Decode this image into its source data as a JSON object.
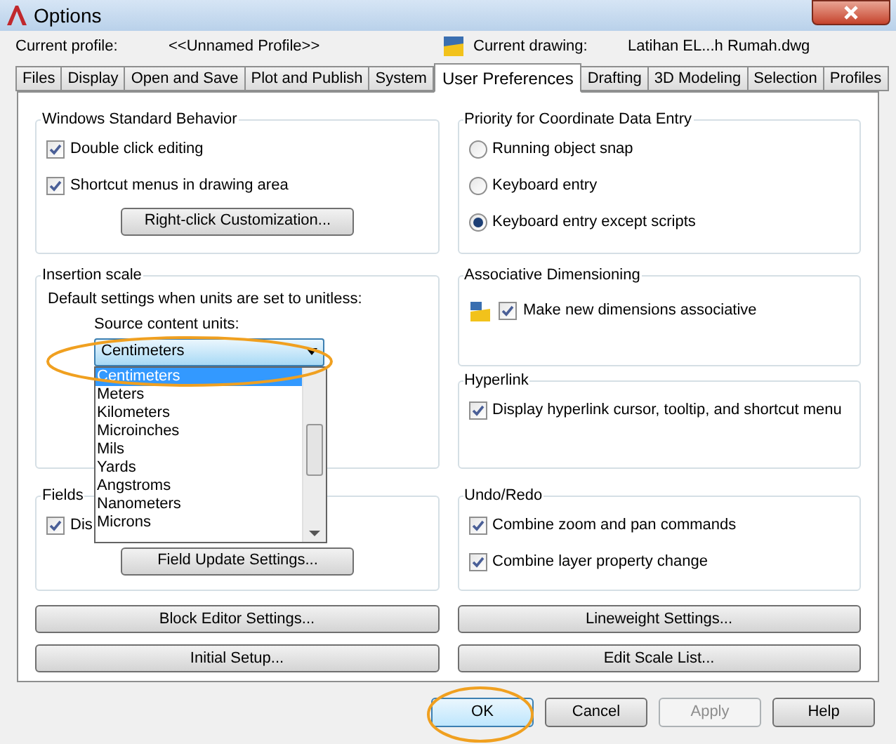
{
  "window": {
    "title": "Options"
  },
  "header": {
    "profile_label": "Current profile:",
    "profile": "<<Unnamed Profile>>",
    "drawing_label": "Current drawing:",
    "drawing": "Latihan EL...h Rumah.dwg"
  },
  "tabs": [
    {
      "label": "Files",
      "selected": false
    },
    {
      "label": "Display",
      "selected": false
    },
    {
      "label": "Open and Save",
      "selected": false
    },
    {
      "label": "Plot and Publish",
      "selected": false
    },
    {
      "label": "System",
      "selected": false
    },
    {
      "label": "User Preferences",
      "selected": true
    },
    {
      "label": "Drafting",
      "selected": false
    },
    {
      "label": "3D Modeling",
      "selected": false
    },
    {
      "label": "Selection",
      "selected": false
    },
    {
      "label": "Profiles",
      "selected": false
    }
  ],
  "left_groups": [
    {
      "title": "Windows Standard Behavior",
      "items": [
        {
          "kind": "checkbox",
          "label": "Double click editing",
          "checked": true
        },
        {
          "kind": "checkbox",
          "label": "Shortcut menus in drawing area",
          "checked": true
        },
        {
          "kind": "button",
          "label": "Right-click Customization..."
        }
      ]
    },
    {
      "title": "Insertion scale",
      "items": [
        {
          "kind": "text",
          "label": "Default settings when units are set to unitless:"
        },
        {
          "kind": "combo",
          "label": "Source content units:",
          "value": "Centimeters",
          "expanded": true,
          "options": [
            {
              "label": "Centimeters",
              "selected": true
            },
            {
              "label": "Meters",
              "selected": false
            },
            {
              "label": "Kilometers",
              "selected": false
            },
            {
              "label": "Microinches",
              "selected": false
            },
            {
              "label": "Mils",
              "selected": false
            },
            {
              "label": "Yards",
              "selected": false
            },
            {
              "label": "Angstroms",
              "selected": false
            },
            {
              "label": "Nanometers",
              "selected": false
            },
            {
              "label": "Microns",
              "selected": false
            }
          ]
        }
      ]
    },
    {
      "title": "Fields",
      "items": [
        {
          "kind": "checkbox",
          "label": "Dis",
          "checked": true
        },
        {
          "kind": "button",
          "label": "Field Update Settings..."
        }
      ]
    }
  ],
  "right_groups": [
    {
      "title": "Priority for Coordinate Data Entry",
      "items": [
        {
          "kind": "radio",
          "label": "Running object snap",
          "selected": false
        },
        {
          "kind": "radio",
          "label": "Keyboard entry",
          "selected": false
        },
        {
          "kind": "radio",
          "label": "Keyboard entry except scripts",
          "selected": true
        }
      ]
    },
    {
      "title": "Associative Dimensioning",
      "items": [
        {
          "kind": "icon_checkbox",
          "label": "Make new dimensions associative",
          "checked": true
        }
      ]
    },
    {
      "title": "Hyperlink",
      "items": [
        {
          "kind": "checkbox",
          "label": "Display hyperlink cursor, tooltip, and shortcut menu",
          "checked": true
        }
      ]
    },
    {
      "title": "Undo/Redo",
      "items": [
        {
          "kind": "checkbox",
          "label": "Combine zoom and pan commands",
          "checked": true
        },
        {
          "kind": "checkbox",
          "label": "Combine layer property change",
          "checked": true
        }
      ]
    }
  ],
  "wide_buttons": [
    {
      "label": "Block Editor Settings..."
    },
    {
      "label": "Lineweight Settings..."
    },
    {
      "label": "Initial Setup..."
    },
    {
      "label": "Edit Scale List..."
    }
  ],
  "dialog_buttons": [
    {
      "label": "OK",
      "default": true,
      "disabled": false
    },
    {
      "label": "Cancel",
      "default": false,
      "disabled": false
    },
    {
      "label": "Apply",
      "default": false,
      "disabled": true
    },
    {
      "label": "Help",
      "default": false,
      "disabled": false
    }
  ]
}
